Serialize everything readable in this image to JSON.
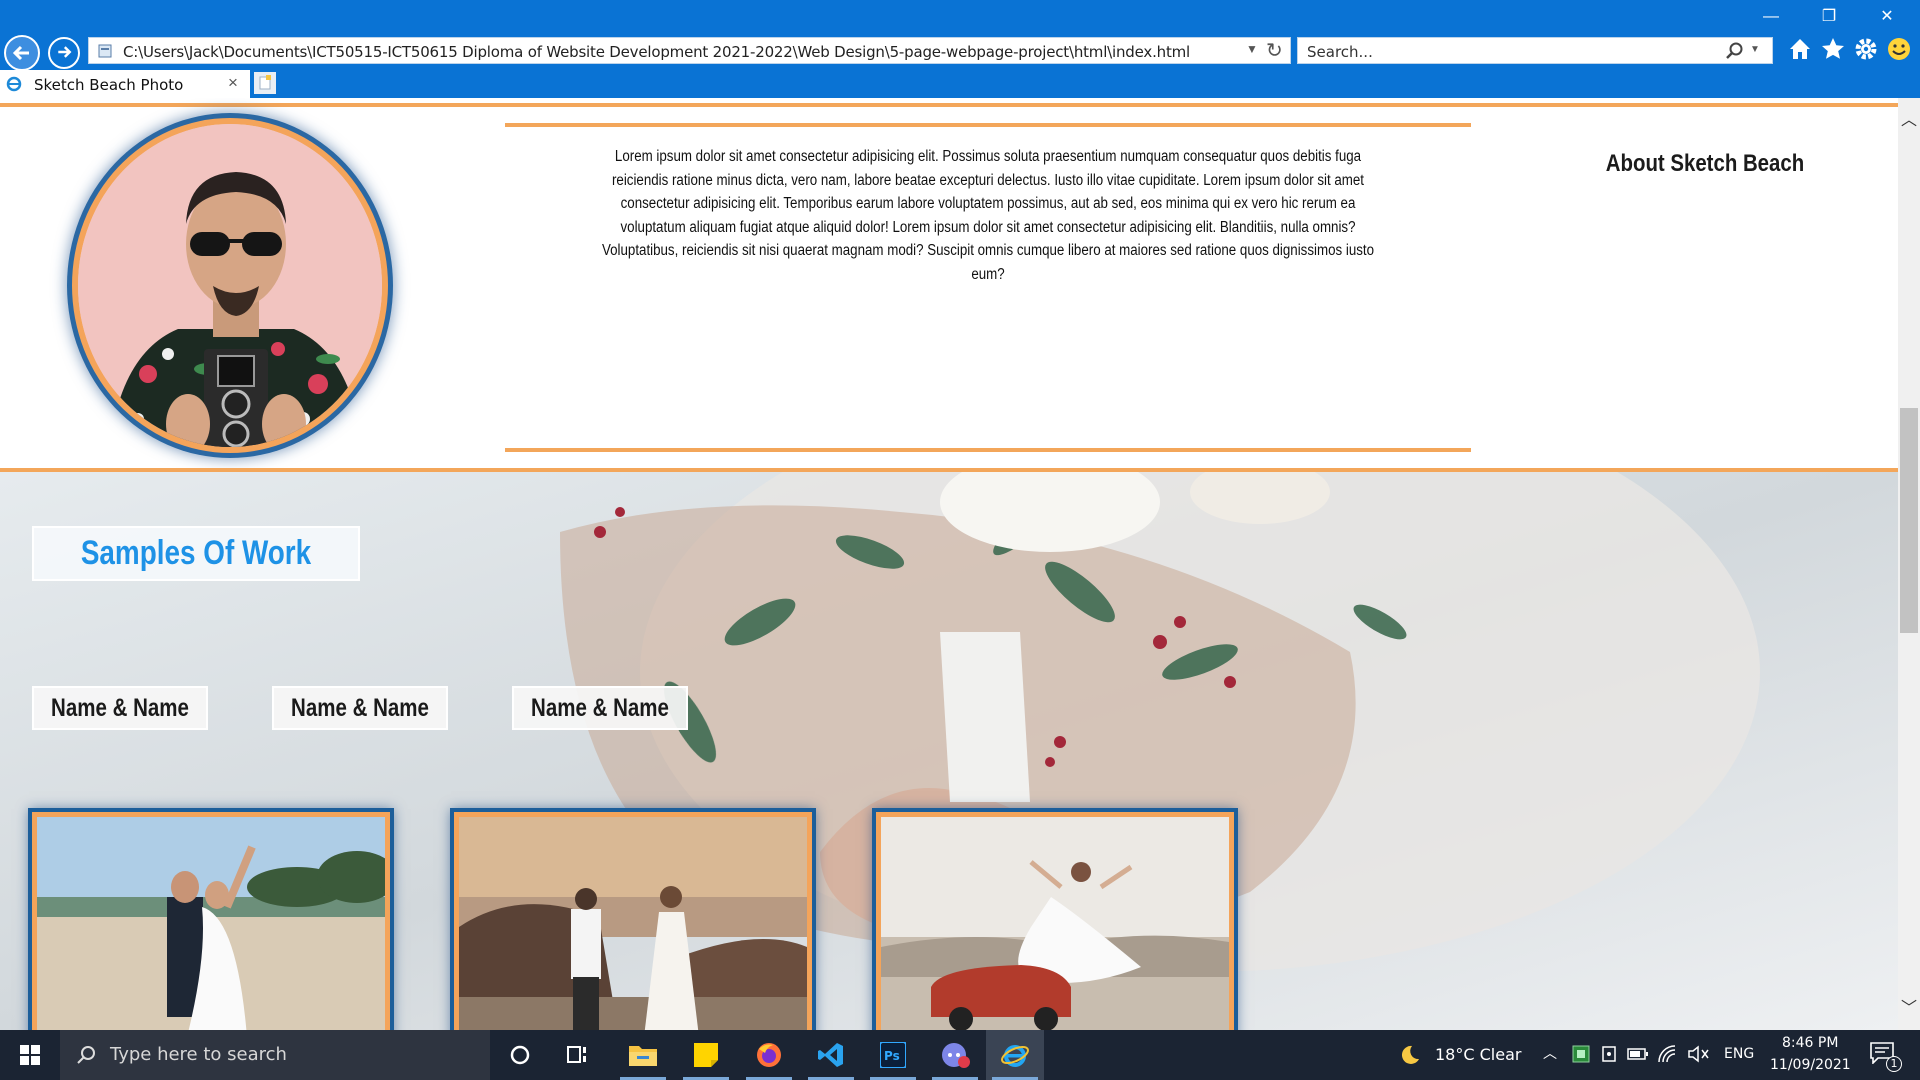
{
  "browser": {
    "address": "C:\\Users\\Jack\\Documents\\ICT50515-ICT50615 Diploma of Website Development 2021-2022\\Web Design\\5-page-webpage-project\\html\\index.html",
    "search_placeholder": "Search...",
    "tab_title": "Sketch Beach Photo",
    "tab_close": "×",
    "minimize": "—",
    "restore": "❐",
    "close": "✕"
  },
  "page": {
    "lorem": "Lorem ipsum dolor sit amet consectetur adipisicing elit. Possimus soluta praesentium numquam consequatur quos debitis fuga reiciendis ratione minus dicta, vero nam, labore beatae excepturi delectus. Iusto illo vitae cupiditate. Lorem ipsum dolor sit amet consectetur adipisicing elit. Temporibus earum labore voluptatem possimus, aut ab sed, eos minima qui ex vero hic rerum ea voluptatum aliquam fugiat atque aliquid dolor! Lorem ipsum dolor sit amet consectetur adipisicing elit. Blanditiis, nulla omnis? Voluptatibus, reiciendis sit nisi quaerat magnam modi? Suscipit omnis cumque libero at maiores sed ratione quos dignissimos iusto eum?",
    "about_heading": "About Sketch Beach",
    "samples_heading": "Samples Of Work",
    "name_buttons": [
      "Name & Name",
      "Name & Name",
      "Name & Name"
    ]
  },
  "taskbar": {
    "search_placeholder": "Type here to search",
    "weather": "18°C  Clear",
    "language": "ENG",
    "time": "8:46 PM",
    "date": "11/09/2021",
    "notification_count": "1"
  },
  "colors": {
    "browser_blue": "#0a73d4",
    "accent_orange": "#f3a65a",
    "heading_blue": "#1e92e6",
    "frame_blue": "#1c5e9a"
  }
}
